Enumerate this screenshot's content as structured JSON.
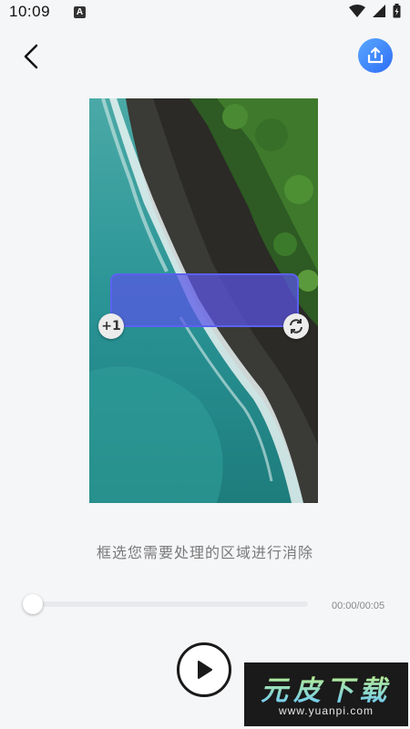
{
  "status_bar": {
    "time": "10:09",
    "notification_icon": "a-letter-icon",
    "icons": [
      "wifi-icon",
      "signal-icon",
      "battery-icon"
    ]
  },
  "header": {
    "back_icon": "chevron-left-icon",
    "share_icon": "share-upload-icon",
    "accent_color": "#2d6df6"
  },
  "selection": {
    "add_label": "+1",
    "rotate_icon": "rotate-icon",
    "fill_color": "#5a55e6"
  },
  "hint": "框选您需要处理的区域进行消除",
  "player": {
    "progress": 0,
    "time": "00:00/00:05",
    "play_icon": "play-icon"
  },
  "watermark": {
    "logo": "元皮下载",
    "url": "www.yuanpi.com"
  }
}
